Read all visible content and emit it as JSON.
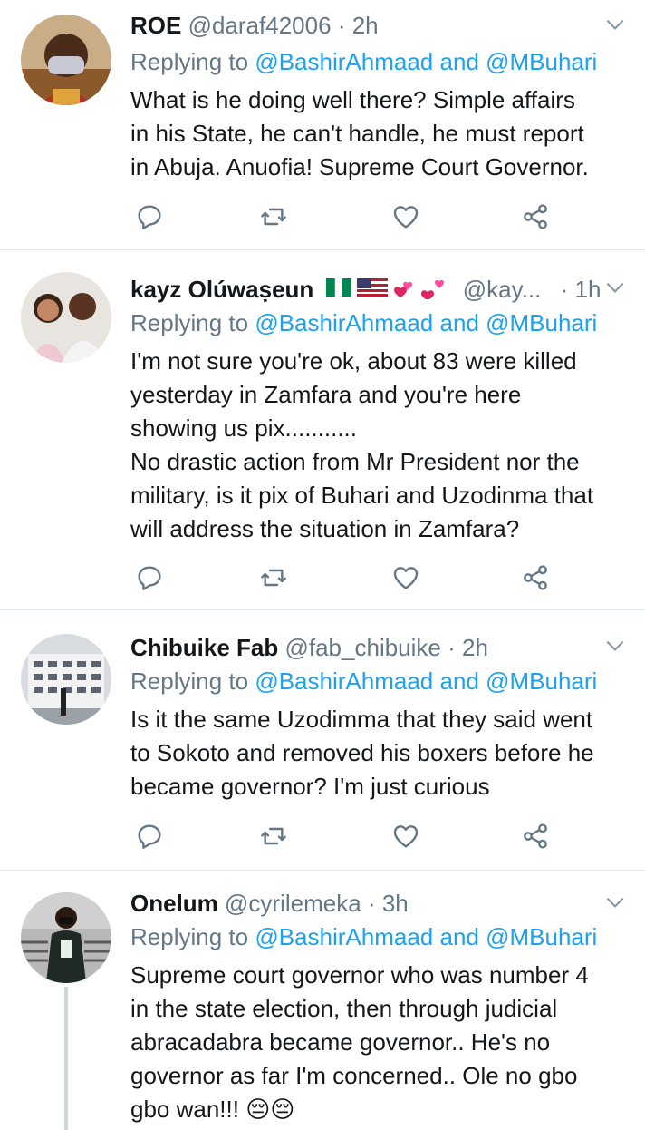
{
  "tweets": [
    {
      "name": "ROE",
      "handle": "@daraf42006",
      "sep": "·",
      "time": "2h",
      "reply_prefix": "Replying to",
      "reply_mention1": "@BashirAhmaad",
      "reply_and": "and",
      "reply_mention2": "@MBuhari",
      "text": "What is he doing well there? Simple affairs\nin his State, he can't handle, he must report\nin Abuja. Anuofia! Supreme Court Governor."
    },
    {
      "name": "kayz Olúwaṣeun",
      "handle": "@kay...",
      "sep": "·",
      "time": "1h",
      "reply_prefix": "Replying to",
      "reply_mention1": "@BashirAhmaad",
      "reply_and": "and",
      "reply_mention2": "@MBuhari",
      "text": "I'm not sure you're ok, about 83 were killed\nyesterday in Zamfara and you're here\nshowing us pix...........\nNo drastic action from Mr President nor the\nmilitary, is it pix of Buhari and Uzodinma that\nwill address the situation in Zamfara?"
    },
    {
      "name": "Chibuike Fab",
      "handle": "@fab_chibuike",
      "sep": "·",
      "time": "2h",
      "reply_prefix": "Replying to",
      "reply_mention1": "@BashirAhmaad",
      "reply_and": "and",
      "reply_mention2": "@MBuhari",
      "text": "Is it the same Uzodimma that they said went\nto Sokoto and removed his boxers before he\nbecame governor? I'm just curious"
    },
    {
      "name": "Onelum",
      "handle": "@cyrilemeka",
      "sep": "·",
      "time": "3h",
      "reply_prefix": "Replying to",
      "reply_mention1": "@BashirAhmaad",
      "reply_and": "and",
      "reply_mention2": "@MBuhari",
      "text": "Supreme court governor who was number 4\nin the state election, then through judicial\nabracadabra became governor.. He's no\ngovernor as far I'm concerned.. Ole no gbo\ngbo wan!!! 😔😔"
    }
  ],
  "icons": {
    "reply": "reply-icon",
    "retweet": "retweet-icon",
    "like": "like-icon",
    "share": "share-icon",
    "caret": "chevron-down-icon"
  },
  "colors": {
    "link": "#1da1f2",
    "muted": "#657786",
    "icon": "#657786",
    "divider": "#e1e8ed"
  }
}
